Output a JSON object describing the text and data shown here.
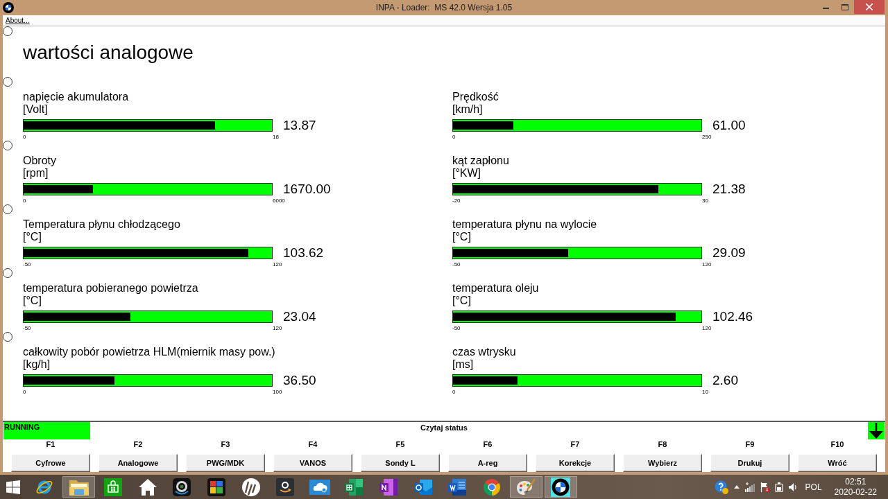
{
  "window": {
    "title": "INPA - Loader:  MS 42.0 Wersja 1.05",
    "menu": [
      "About..."
    ]
  },
  "screen": {
    "marker": {
      "selected": false
    },
    "title": "wartości analogowe",
    "rows": [
      {
        "marker": {
          "selected": false
        },
        "gauges": [
          {
            "label": "napięcie akumulatora",
            "unit": "[Volt]",
            "level": 0.77,
            "value": "13.87",
            "min": "0",
            "max": "18"
          },
          {
            "label": "Prędkość",
            "unit": "[km/h]",
            "level": 0.244,
            "value": "61.00",
            "min": "0",
            "max": "250"
          }
        ]
      },
      {
        "marker": {
          "selected": false
        },
        "gauges": [
          {
            "label": "Obroty",
            "unit": "[rpm]",
            "level": 0.278,
            "value": "1670.00",
            "min": "0",
            "max": "6000"
          },
          {
            "label": "kąt zapłonu",
            "unit": "[°KW]",
            "level": 0.828,
            "value": "21.38",
            "min": "-20",
            "max": "30"
          }
        ]
      },
      {
        "marker": {
          "selected": false
        },
        "gauges": [
          {
            "label": "Temperatura płynu chłodzącego",
            "unit": "[°C]",
            "level": 0.904,
            "value": "103.62",
            "min": "-50",
            "max": "120"
          },
          {
            "label": "temperatura płynu na wylocie",
            "unit": "[°C]",
            "level": 0.465,
            "value": "29.09",
            "min": "-50",
            "max": "120"
          }
        ]
      },
      {
        "marker": {
          "selected": false
        },
        "gauges": [
          {
            "label": "temperatura pobieranego powietrza",
            "unit": "[°C]",
            "level": 0.43,
            "value": "23.04",
            "min": "-50",
            "max": "120"
          },
          {
            "label": "temperatura oleju",
            "unit": "[°C]",
            "level": 0.897,
            "value": "102.46",
            "min": "-50",
            "max": "120"
          }
        ]
      },
      {
        "marker": {
          "selected": false
        },
        "gauges": [
          {
            "label": "całkowity pobór powietrza HLM(miernik masy pow.)",
            "unit": "[kg/h]",
            "level": 0.365,
            "value": "36.50",
            "min": "0",
            "max": "100"
          },
          {
            "label": "czas wtrysku",
            "unit": "[ms]",
            "level": 0.26,
            "value": "2.60",
            "min": "0",
            "max": "10"
          }
        ]
      }
    ]
  },
  "status": {
    "state": "RUNNING",
    "message": "Czytaj status"
  },
  "function_keys": [
    {
      "key": "F1",
      "label": "Cyfrowe"
    },
    {
      "key": "F2",
      "label": "Analogowe"
    },
    {
      "key": "F3",
      "label": "PWG/MDK"
    },
    {
      "key": "F4",
      "label": "VANOS"
    },
    {
      "key": "F5",
      "label": "Sondy L"
    },
    {
      "key": "F6",
      "label": "A-reg"
    },
    {
      "key": "F7",
      "label": "Korekcje"
    },
    {
      "key": "F8",
      "label": "Wybierz"
    },
    {
      "key": "F9",
      "label": "Drukuj"
    },
    {
      "key": "F10",
      "label": "Wróć"
    }
  ],
  "taskbar": {
    "apps": [
      {
        "kind": "start",
        "open": false
      },
      {
        "kind": "ie",
        "open": false
      },
      {
        "kind": "folder",
        "open": true
      },
      {
        "kind": "store",
        "open": false
      },
      {
        "kind": "home",
        "open": false
      },
      {
        "kind": "webcam",
        "open": false
      },
      {
        "kind": "puzzle",
        "open": false
      },
      {
        "kind": "hp",
        "open": false
      },
      {
        "kind": "amazon",
        "open": false
      },
      {
        "kind": "cloud",
        "open": false
      },
      {
        "kind": "excel",
        "open": false
      },
      {
        "kind": "onenote",
        "open": false
      },
      {
        "kind": "outlook",
        "open": false
      },
      {
        "kind": "word",
        "open": false
      },
      {
        "kind": "chrome",
        "open": false
      },
      {
        "kind": "paint",
        "open": true
      },
      {
        "kind": "roundel",
        "open": true
      }
    ],
    "tray": {
      "language": "POL",
      "time": "02:51",
      "date": "2020-02-22"
    }
  }
}
